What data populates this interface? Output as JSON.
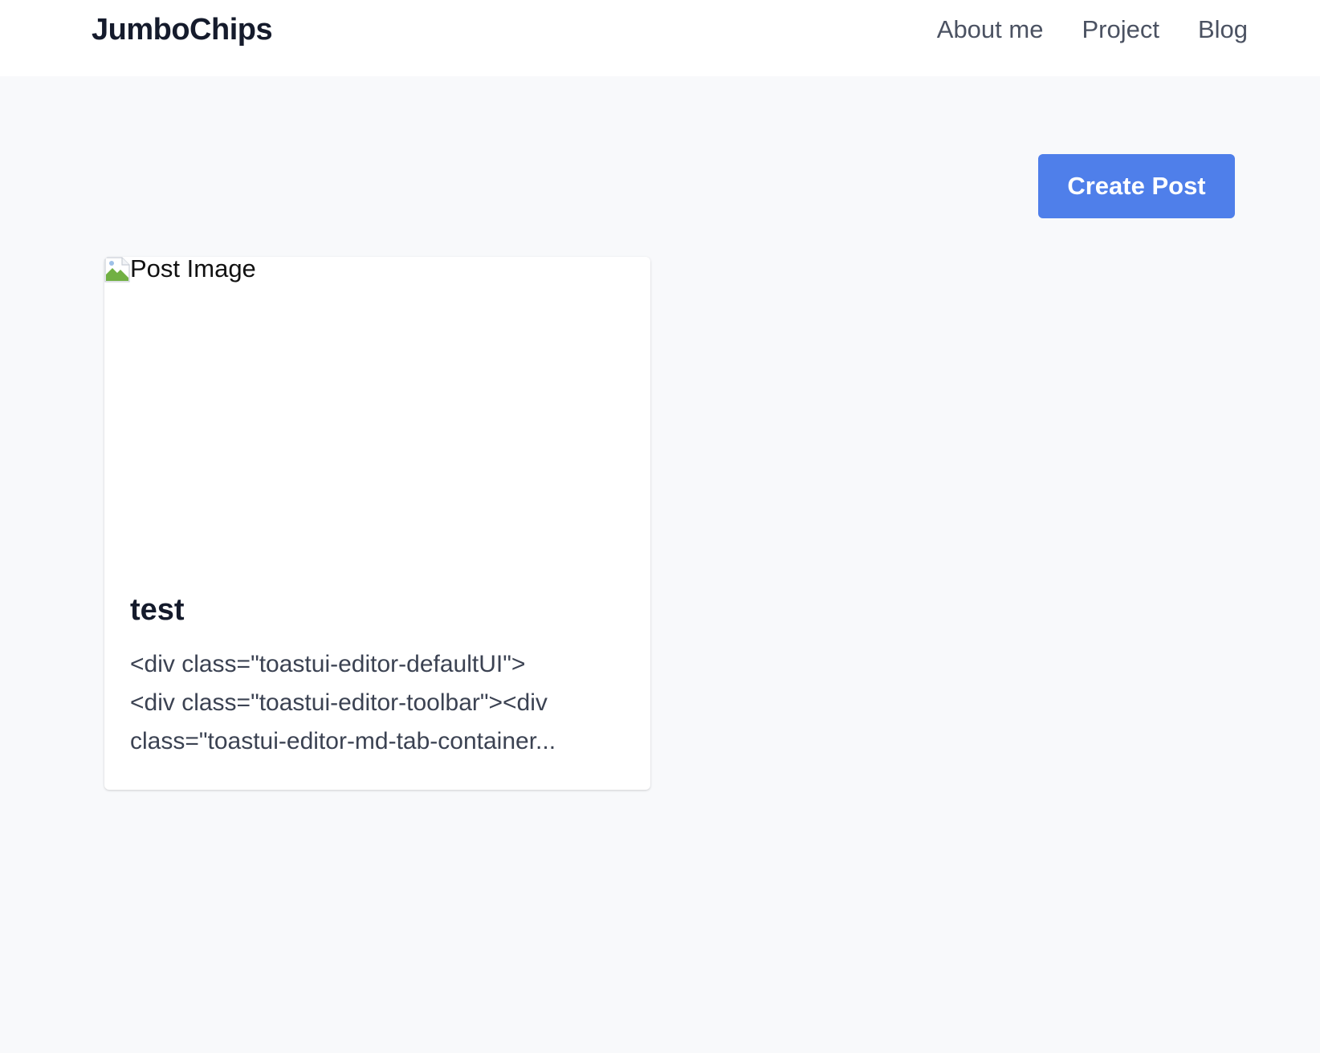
{
  "navbar": {
    "brand": "JumboChips",
    "links": [
      "About me",
      "Project",
      "Blog"
    ]
  },
  "actions": {
    "create_post_label": "Create Post"
  },
  "posts": [
    {
      "image_alt": "Post Image",
      "title": "test",
      "excerpt_lines": [
        "<div class=\"toastui-editor-defaultUI\">",
        "<div class=\"toastui-editor-toolbar\"><div",
        "class=\"toastui-editor-md-tab-container..."
      ]
    }
  ],
  "colors": {
    "accent": "#4f7fea",
    "background": "#f8f9fb",
    "heading": "#151b2c",
    "nav_text": "#4b5262"
  },
  "icons": {
    "broken_image": "broken-image-icon"
  }
}
